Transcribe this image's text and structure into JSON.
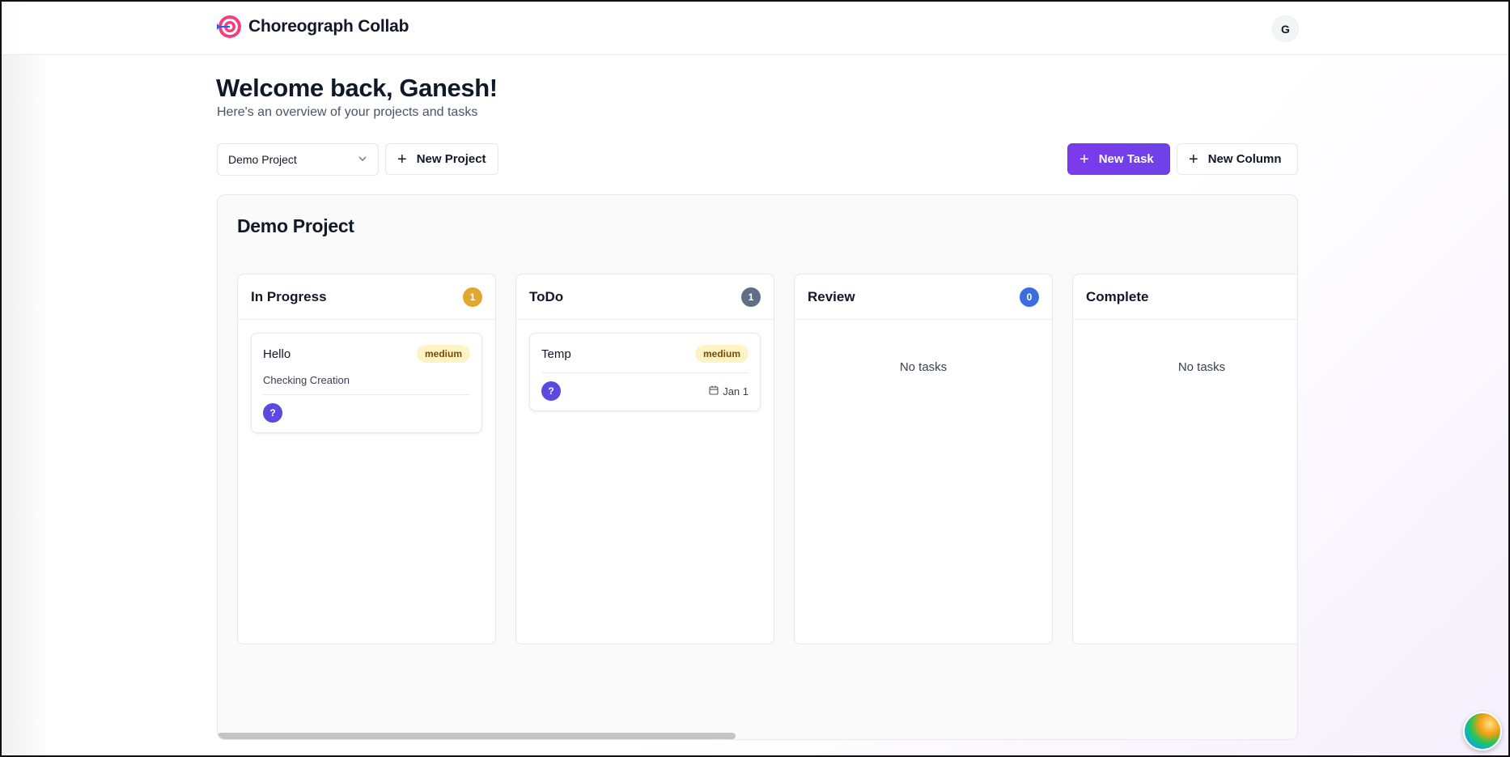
{
  "header": {
    "app_name": "Choreograph Collab",
    "user_initial": "G"
  },
  "welcome": {
    "title": "Welcome back, Ganesh!",
    "subtitle": "Here's an overview of your projects and tasks"
  },
  "controls": {
    "project_select_value": "Demo Project",
    "new_project_label": "New Project",
    "new_task_label": "New Task",
    "new_column_label": "New Column"
  },
  "board": {
    "title": "Demo Project",
    "columns": [
      {
        "title": "In Progress",
        "count": "1",
        "count_color": "#e3a62f",
        "tasks": [
          {
            "title": "Hello",
            "priority": "medium",
            "description": "Checking Creation",
            "assignee": "?",
            "due": ""
          }
        ]
      },
      {
        "title": "ToDo",
        "count": "1",
        "count_color": "#5f6f85",
        "tasks": [
          {
            "title": "Temp",
            "priority": "medium",
            "description": "",
            "assignee": "?",
            "due": "Jan 1"
          }
        ]
      },
      {
        "title": "Review",
        "count": "0",
        "count_color": "#3b6fe0",
        "empty_text": "No tasks"
      },
      {
        "title": "Complete",
        "count": "",
        "empty_text": "No tasks"
      }
    ]
  },
  "colors": {
    "primary": "#7c3aed",
    "badge_bg": "#fdf3c4",
    "assignee": "#5b4ae0"
  }
}
